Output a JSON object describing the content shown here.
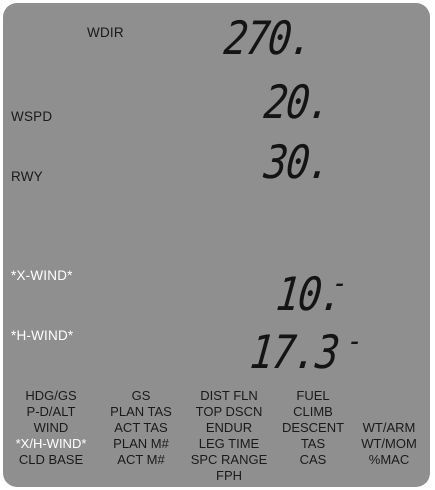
{
  "display": {
    "rows": [
      {
        "label": "WDIR",
        "value": "270.",
        "suffix": "",
        "label_active": false
      },
      {
        "label": "WSPD",
        "value": "20.",
        "suffix": "",
        "label_active": false
      },
      {
        "label": "RWY",
        "value": "30.",
        "suffix": "",
        "label_active": false
      },
      {
        "label": "*X-WIND*",
        "value": "10.",
        "suffix": "-",
        "label_active": true
      },
      {
        "label": "*H-WIND*",
        "value": "17.3",
        "suffix": "-",
        "label_active": true
      }
    ]
  },
  "menu": {
    "columns": [
      {
        "items": [
          "HDG/GS",
          "P-D/ALT",
          "WIND",
          "*X/H-WIND*",
          "CLD BASE"
        ],
        "active_index": 3
      },
      {
        "items": [
          "GS",
          "PLAN TAS",
          "ACT TAS",
          "PLAN M#",
          "ACT M#"
        ],
        "active_index": -1
      },
      {
        "items": [
          "DIST FLN",
          "TOP DSCN",
          "ENDUR",
          "LEG TIME",
          "SPC RANGE",
          "FPH"
        ],
        "active_index": -1
      },
      {
        "items": [
          "FUEL",
          "CLIMB",
          "DESCENT",
          "TAS",
          "CAS"
        ],
        "active_index": -1
      },
      {
        "items": [
          "WT/ARM",
          "WT/MOM",
          "%MAC"
        ],
        "active_index": -1
      }
    ]
  },
  "colors": {
    "lcd_background": "#8f8f8f",
    "active_label": "#ffffff",
    "segment": "#141414"
  }
}
